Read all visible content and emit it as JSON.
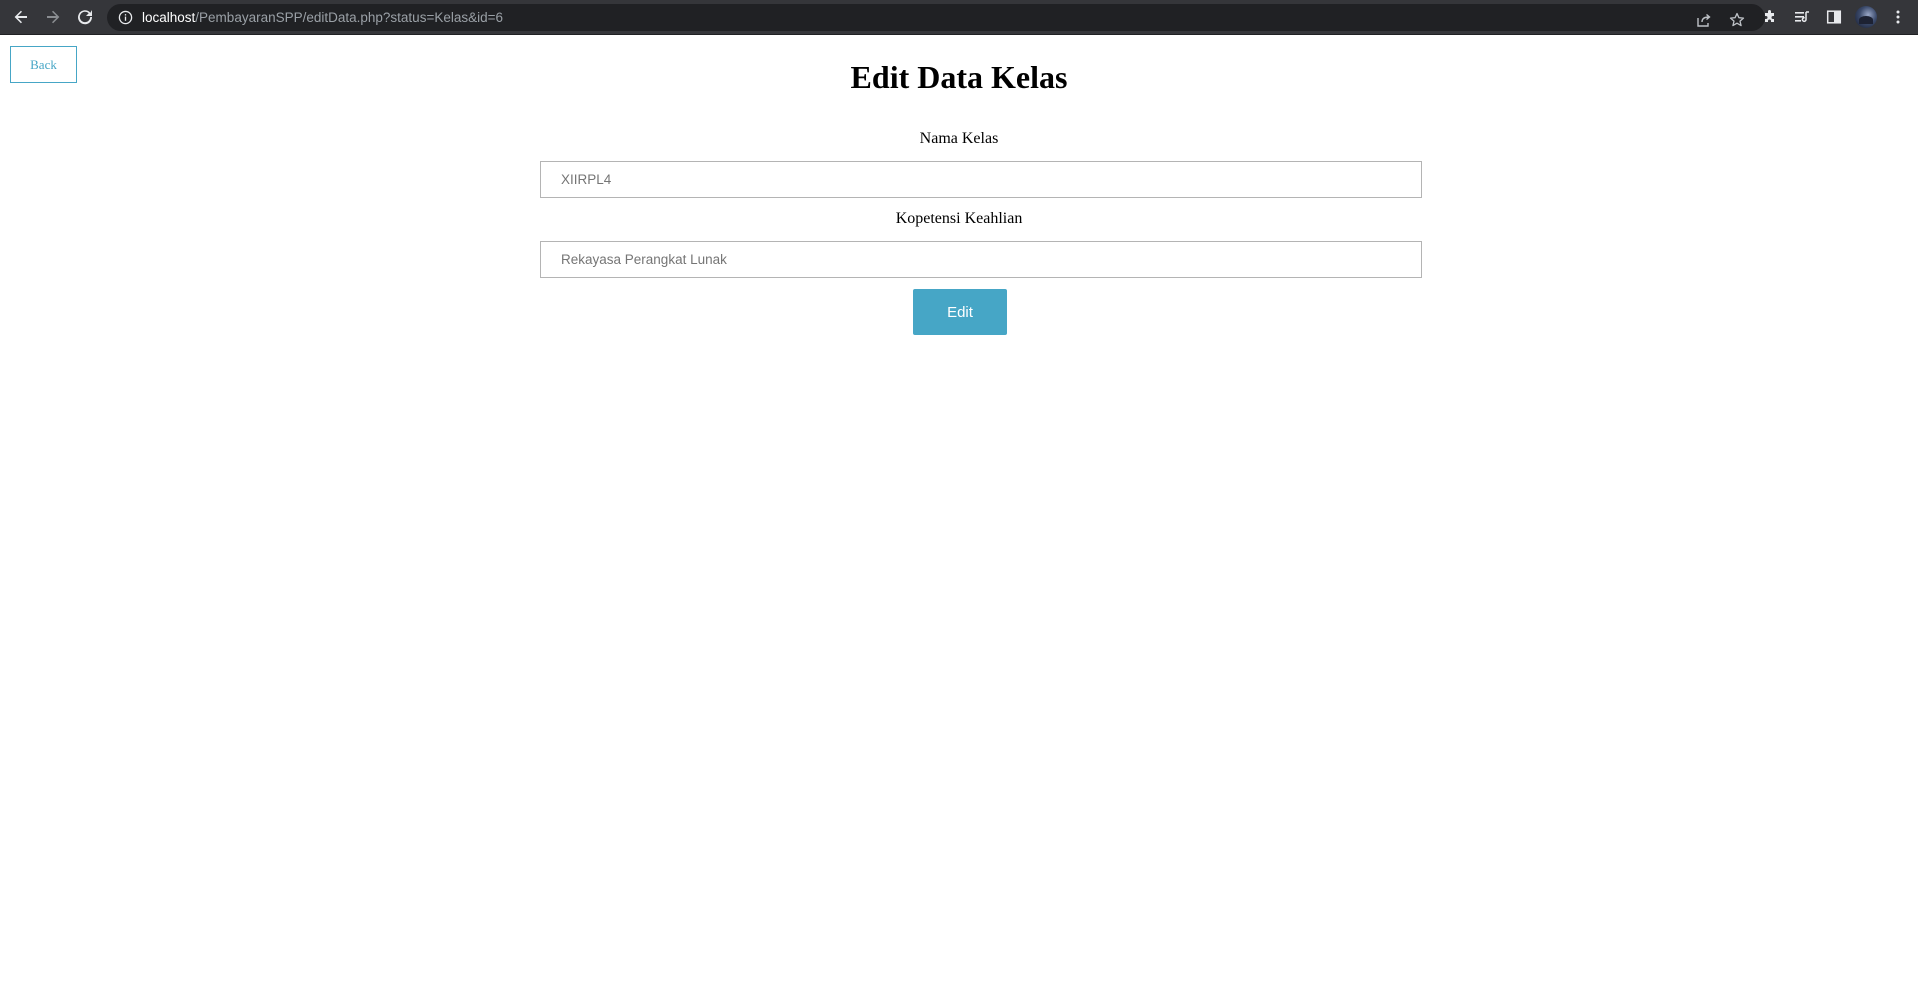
{
  "browser": {
    "url_host": "localhost",
    "url_path": "/PembayaranSPP/editData.php?status=Kelas&id=6",
    "icons": {
      "back": "arrow-left-icon",
      "forward": "arrow-right-icon",
      "reload": "reload-icon",
      "site_info": "info-icon",
      "share": "share-icon",
      "bookmark": "star-icon",
      "extensions": "puzzle-icon",
      "reading_list": "reading-list-icon",
      "side_panel": "side-panel-icon",
      "profile": "avatar",
      "menu": "kebab-menu-icon"
    }
  },
  "page": {
    "back_label": "Back",
    "title": "Edit Data Kelas",
    "fields": [
      {
        "label": "Nama Kelas",
        "placeholder": "XIIRPL4"
      },
      {
        "label": "Kopetensi Keahlian",
        "placeholder": "Rekayasa Perangkat Lunak"
      }
    ],
    "submit_label": "Edit"
  },
  "colors": {
    "accent": "#46a6c6",
    "chrome_dark": "#35363a",
    "omnibox": "#202124"
  }
}
